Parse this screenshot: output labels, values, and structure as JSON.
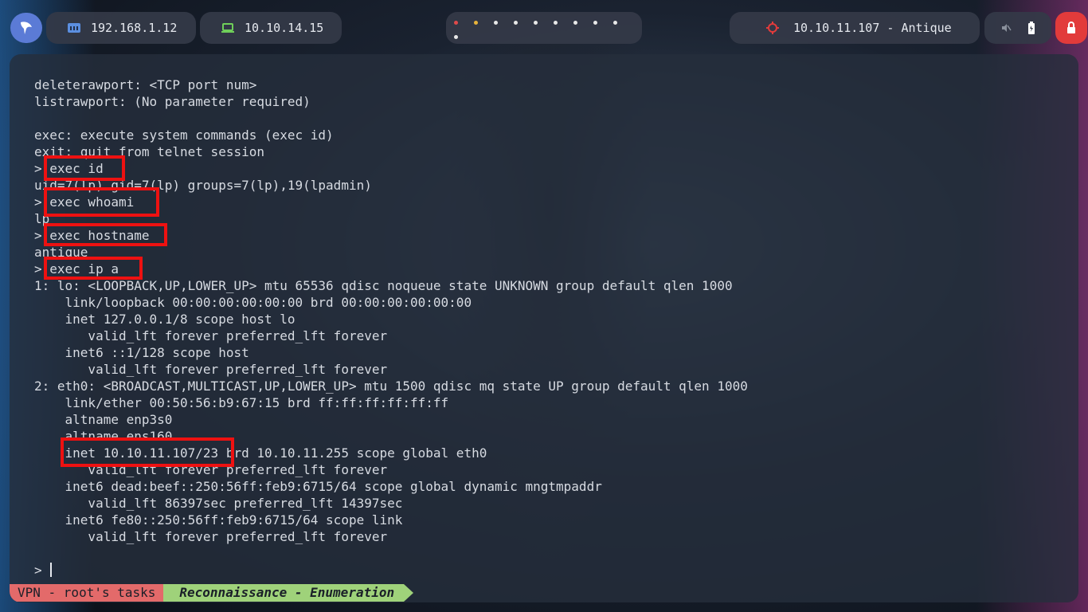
{
  "topbar": {
    "host_ip": "192.168.1.12",
    "vpn_ip": "10.10.14.15",
    "target": "10.10.11.107 - Antique",
    "workspace_dots": [
      "#e04a4a",
      "#e8b33a",
      "#e8e8e8",
      "#e8e8e8",
      "#e8e8e8",
      "#e8e8e8",
      "#e8e8e8",
      "#e8e8e8",
      "#e8e8e8",
      "#e8e8e8"
    ],
    "icons": {
      "logo": "parrot-logo-icon",
      "host": "ethernet-icon",
      "vpn": "laptop-icon",
      "target": "crosshair-icon",
      "volume": "volume-muted-icon",
      "battery": "battery-icon",
      "power": "power-icon"
    },
    "colors": {
      "logo": "#5b7bd6",
      "host_icon": "#5b8fe0",
      "vpn_icon": "#6fcf5a",
      "target_icon": "#e23b3b",
      "power": "#e23b3b"
    }
  },
  "terminal": {
    "lines": [
      "deleterawport: <TCP port num>",
      "listrawport: (No parameter required)",
      "",
      "exec: execute system commands (exec id)",
      "exit: quit from telnet session",
      "> exec id",
      "uid=7(lp) gid=7(lp) groups=7(lp),19(lpadmin)",
      "> exec whoami",
      "lp",
      "> exec hostname",
      "antique",
      "> exec ip a",
      "1: lo: <LOOPBACK,UP,LOWER_UP> mtu 65536 qdisc noqueue state UNKNOWN group default qlen 1000",
      "    link/loopback 00:00:00:00:00:00 brd 00:00:00:00:00:00",
      "    inet 127.0.0.1/8 scope host lo",
      "       valid_lft forever preferred_lft forever",
      "    inet6 ::1/128 scope host",
      "       valid_lft forever preferred_lft forever",
      "2: eth0: <BROADCAST,MULTICAST,UP,LOWER_UP> mtu 1500 qdisc mq state UP group default qlen 1000",
      "    link/ether 00:50:56:b9:67:15 brd ff:ff:ff:ff:ff:ff",
      "    altname enp3s0",
      "    altname ens160",
      "    inet 10.10.11.107/23 brd 10.10.11.255 scope global eth0",
      "       valid_lft forever preferred_lft forever",
      "    inet6 dead:beef::250:56ff:feb9:6715/64 scope global dynamic mngtmpaddr",
      "       valid_lft 86397sec preferred_lft 14397sec",
      "    inet6 fe80::250:56ff:feb9:6715/64 scope link",
      "       valid_lft forever preferred_lft forever",
      ""
    ],
    "prompt": ">",
    "highlight_color": "#ee1111"
  },
  "statusbar": {
    "segment1": "VPN - root's tasks",
    "segment2": "Reconnaissance - Enumeration",
    "colors": {
      "segment1": "#e36a6a",
      "segment2": "#9fd27a"
    }
  }
}
